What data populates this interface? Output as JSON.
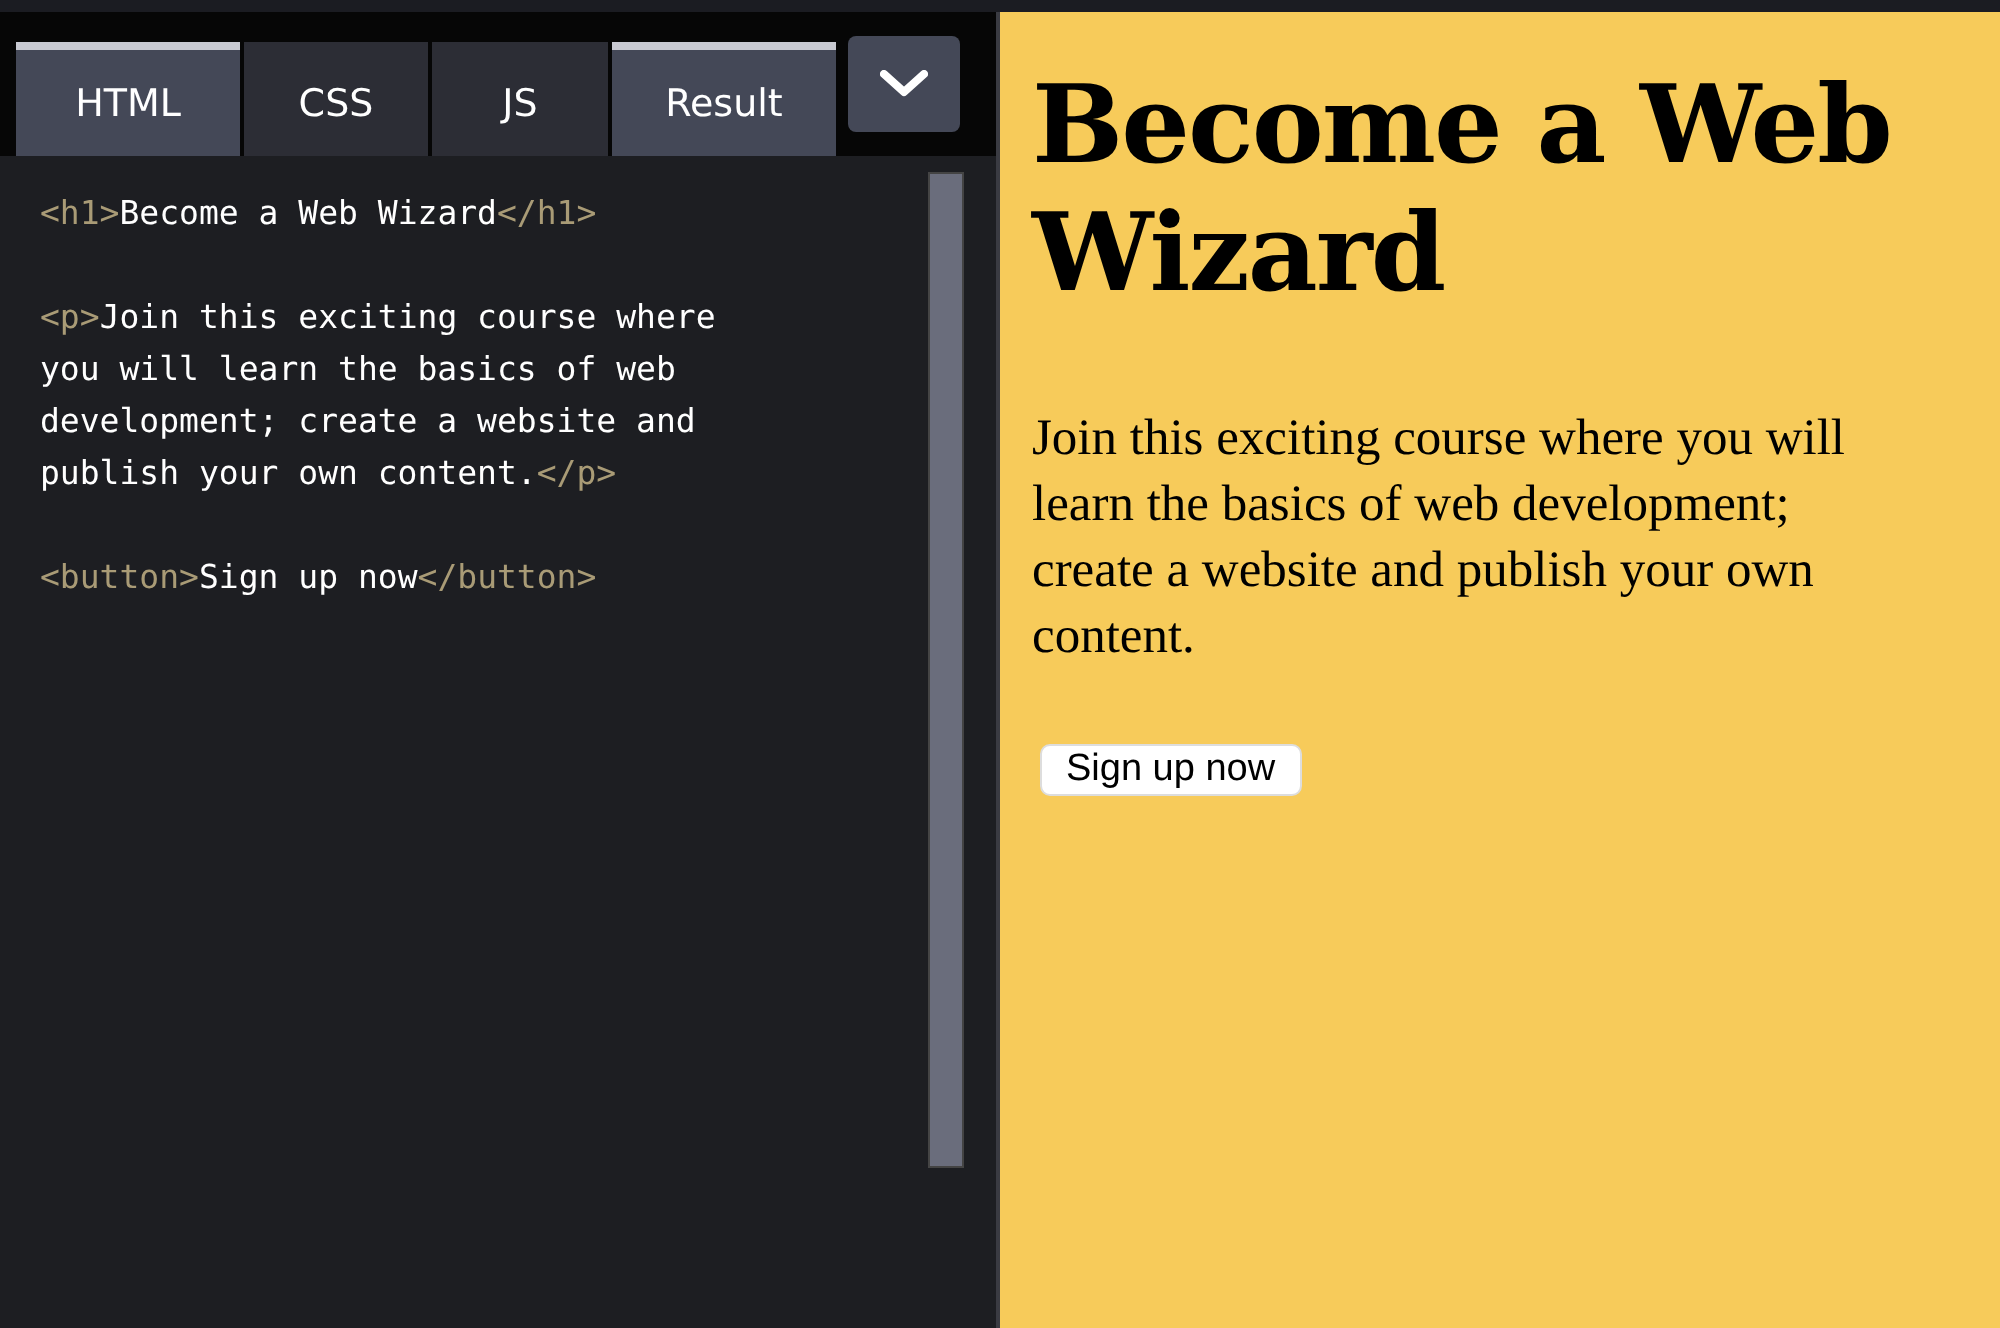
{
  "tabs": [
    {
      "label": "HTML",
      "selected": true
    },
    {
      "label": "CSS",
      "selected": false
    },
    {
      "label": "JS",
      "selected": false
    },
    {
      "label": "Result",
      "selected": true
    }
  ],
  "code_blocks": [
    {
      "lines": [
        [
          {
            "kind": "tag",
            "text": "<h1>"
          },
          {
            "kind": "text",
            "text": "Become a Web Wizard"
          },
          {
            "kind": "tag",
            "text": "</h1>"
          }
        ]
      ]
    },
    {
      "lines": [
        [
          {
            "kind": "tag",
            "text": "<p>"
          },
          {
            "kind": "text",
            "text": "Join this exciting course where"
          }
        ],
        [
          {
            "kind": "text",
            "text": "you will learn the basics of web"
          }
        ],
        [
          {
            "kind": "text",
            "text": "development; create a website and"
          }
        ],
        [
          {
            "kind": "text",
            "text": "publish your own content."
          },
          {
            "kind": "tag",
            "text": "</p>"
          }
        ]
      ]
    },
    {
      "lines": [
        [
          {
            "kind": "tag",
            "text": "<button>"
          },
          {
            "kind": "text",
            "text": "Sign up now"
          },
          {
            "kind": "tag",
            "text": "</button>"
          }
        ]
      ]
    }
  ],
  "preview": {
    "heading": "Become a Web Wizard",
    "paragraph": "Join this exciting course where you will learn the basics of web development; create a website and publish your own content.",
    "button": "Sign up now"
  }
}
